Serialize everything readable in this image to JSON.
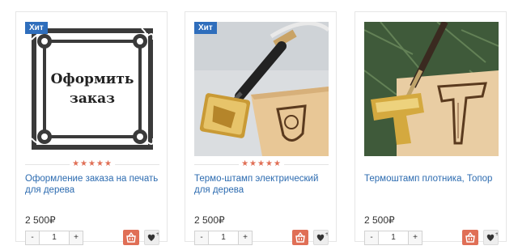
{
  "products": [
    {
      "badge": "Хит",
      "image_text_line1": "Оформить",
      "image_text_line2": "заказ",
      "rating": "★★★★★",
      "title": "Оформление заказа на печать для дерева",
      "price": "2 500₽",
      "qty_minus": "-",
      "qty_value": "1",
      "qty_plus": "+",
      "cart_icon": "basket-icon",
      "fav_icon": "heart-icon"
    },
    {
      "badge": "Хит",
      "rating": "★★★★★",
      "title": "Термо-штамп электрический для дерева",
      "price": "2 500₽",
      "qty_minus": "-",
      "qty_value": "1",
      "qty_plus": "+",
      "cart_icon": "basket-icon",
      "fav_icon": "heart-icon"
    },
    {
      "title": "Термоштамп плотника, Топор",
      "price": "2 500₽",
      "qty_minus": "-",
      "qty_value": "1",
      "qty_plus": "+",
      "cart_icon": "basket-icon",
      "fav_icon": "heart-icon"
    }
  ],
  "colors": {
    "accent": "#2f6ebc",
    "link": "#2c6bb0",
    "cart": "#e06f56",
    "stars": "#e06f56"
  }
}
